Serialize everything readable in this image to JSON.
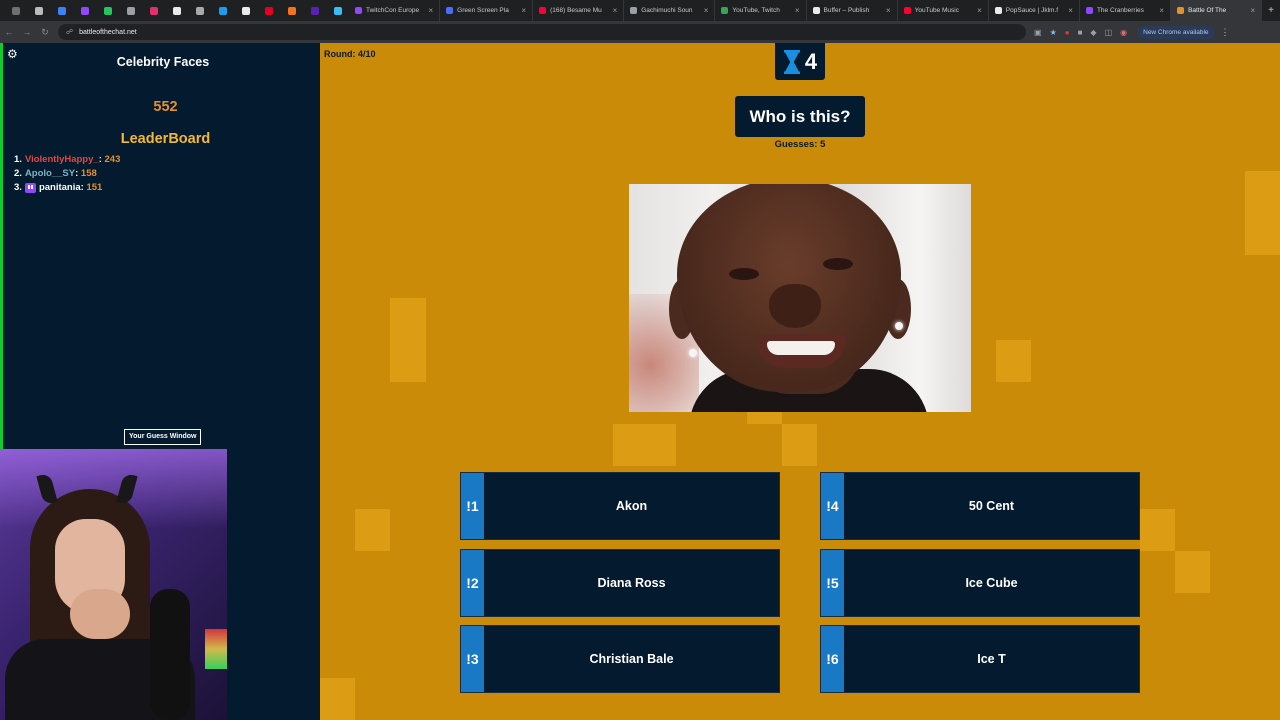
{
  "browser": {
    "tabs": [
      {
        "title": "TwitchCon Europe",
        "color": "#9146ff"
      },
      {
        "title": "Green Screen Pla",
        "color": "#4b6cff"
      },
      {
        "title": "(168) Besame Mu",
        "color": "#ff0033"
      },
      {
        "title": "Gachimuchi Soun",
        "color": "#9aa0a6"
      },
      {
        "title": "YouTube, Twitch",
        "color": "#34a853"
      },
      {
        "title": "Buffer – Publish",
        "color": "#e8eaed"
      },
      {
        "title": "YouTube Music",
        "color": "#ff0033"
      },
      {
        "title": "PopSauce | Jklm.f",
        "color": "#e8eaed"
      },
      {
        "title": "The Cranberries",
        "color": "#9146ff"
      },
      {
        "title": "Battle Of The",
        "color": "#e3912a",
        "active": true
      }
    ],
    "url": "battleofthechat.net",
    "update_pill": "New Chrome available"
  },
  "left": {
    "title": "Celebrity Faces",
    "score": "552",
    "leaderboard_title": "LeaderBoard",
    "leaderboard": [
      {
        "rank": "1.",
        "name": "ViolentlyHappy_",
        "points": "243"
      },
      {
        "rank": "2.",
        "name": "Apolo__SY",
        "points": "158"
      },
      {
        "rank": "3.",
        "name": "panitania",
        "points": "151"
      }
    ],
    "guess_window_button": "Your Guess Window"
  },
  "game": {
    "round_label": "Round:",
    "round_value": "4/10",
    "timer": "4",
    "question": "Who is this?",
    "guesses_label": "Guesses:",
    "guesses_value": "5",
    "answers": [
      {
        "key": "!1",
        "label": "Akon"
      },
      {
        "key": "!2",
        "label": "Diana Ross"
      },
      {
        "key": "!3",
        "label": "Christian Bale"
      },
      {
        "key": "!4",
        "label": "50 Cent"
      },
      {
        "key": "!5",
        "label": "Ice Cube"
      },
      {
        "key": "!6",
        "label": "Ice T"
      }
    ]
  },
  "colors": {
    "game_bg": "#c98b08",
    "panel_bg": "#041a2f",
    "key_blue": "#1979c5",
    "score_orange": "#e3912a",
    "leaderboard_gold": "#f4b933"
  }
}
